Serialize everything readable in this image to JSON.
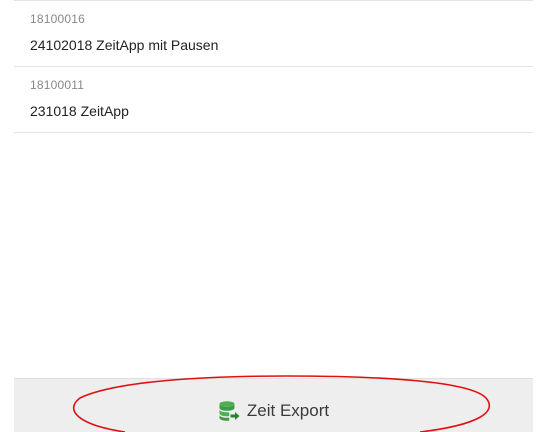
{
  "list": {
    "items": [
      {
        "id": "18100016",
        "title": "24102018 ZeitApp mit Pausen"
      },
      {
        "id": "18100011",
        "title": "231018 ZeitApp"
      }
    ]
  },
  "footer": {
    "export_label": "Zeit Export",
    "export_icon": "database-export-icon"
  },
  "colors": {
    "icon_green": "#4caf50",
    "annotation_red": "#e01010",
    "footer_bg": "#eeeeee"
  }
}
